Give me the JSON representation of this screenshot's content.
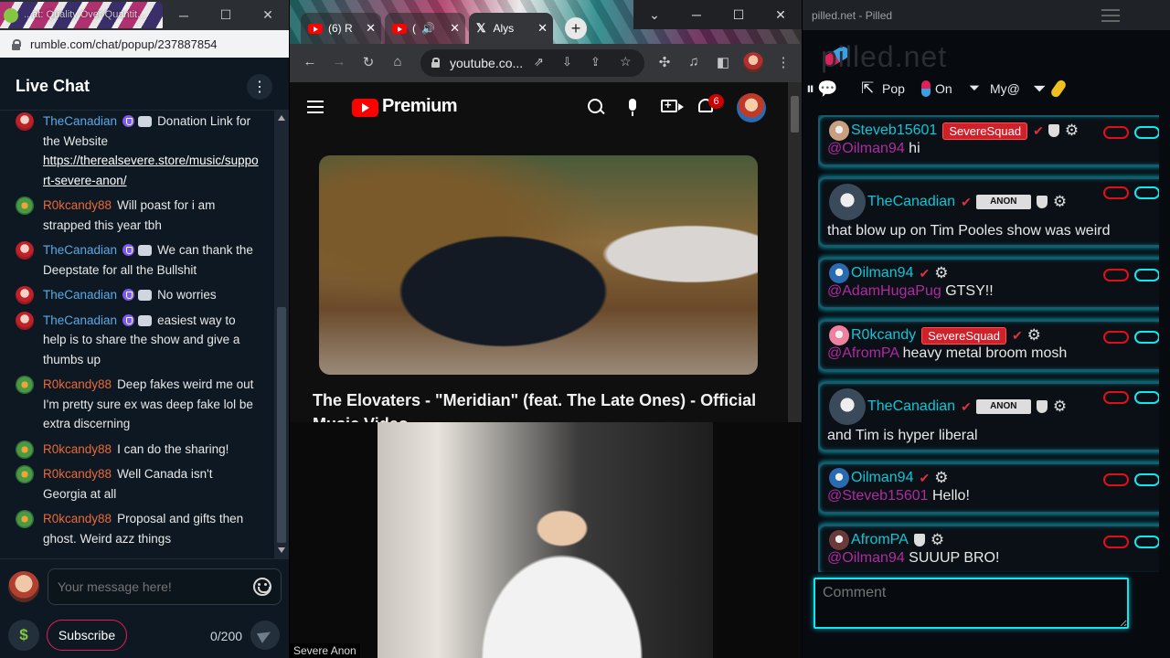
{
  "rumble": {
    "tab_title": "...at: Quality Over Quantit...",
    "url": "rumble.com/chat/popup/237887854",
    "header_title": "Live Chat",
    "messages": [
      {
        "user": "TheCanadian",
        "kind": "tc",
        "badges": true,
        "text": "Donation Link for the Website ",
        "link": "https://therealsevere.store/music/support-severe-anon/"
      },
      {
        "user": "R0kcandy88",
        "kind": "r0",
        "badges": false,
        "text": "Will poast for i am strapped this year tbh"
      },
      {
        "user": "TheCanadian",
        "kind": "tc",
        "badges": true,
        "text": "We can thank the Deepstate for all the Bullshit"
      },
      {
        "user": "TheCanadian",
        "kind": "tc",
        "badges": true,
        "text": "No worries"
      },
      {
        "user": "TheCanadian",
        "kind": "tc",
        "badges": true,
        "text": "easiest way to help is to share the show and give a thumbs up"
      },
      {
        "user": "R0kcandy88",
        "kind": "r0",
        "badges": false,
        "text": "Deep fakes weird me out I'm pretty sure ex was deep fake lol be extra discerning"
      },
      {
        "user": "R0kcandy88",
        "kind": "r0",
        "badges": false,
        "text": "I can do the sharing!"
      },
      {
        "user": "R0kcandy88",
        "kind": "r0",
        "badges": false,
        "text": "Well Canada isn't Georgia at all"
      },
      {
        "user": "R0kcandy88",
        "kind": "r0",
        "badges": false,
        "text": "Proposal and gifts then ghost. Weird azz things"
      }
    ],
    "input_placeholder": "Your message here!",
    "subscribe_label": "Subscribe",
    "char_counter": "0/200",
    "dollar_symbol": "$"
  },
  "youtube": {
    "tabs": [
      {
        "label": "(6) R"
      },
      {
        "label": "("
      },
      {
        "label": "Alys"
      }
    ],
    "url": "youtube.co...",
    "brand": "Premium",
    "notification_count": "6",
    "video_title": "The Elovaters - \"Meridian\" (feat. The Late Ones) - Official Music Video"
  },
  "webcam": {
    "label": "Severe Anon"
  },
  "pilled": {
    "window_title": "pilled.net - Pilled",
    "logo_text": "pilled.net",
    "toolbar": {
      "pop": "Pop",
      "on": "On",
      "my": "My@"
    },
    "messages": [
      {
        "user": "Steveb15601",
        "badge": "SevereSquad",
        "mention": "@Oilman94",
        "text": " hi"
      },
      {
        "user": "TheCanadian",
        "anon_badge": "ANON",
        "mention": "",
        "text": "that blow up on Tim Pooles show was weird"
      },
      {
        "user": "Oilman94",
        "mention": "@AdamHugaPug",
        "text": " GTSY!!"
      },
      {
        "user": "R0kcandy",
        "badge": "SevereSquad",
        "mention": "@AfromPA",
        "text": " heavy metal broom mosh"
      },
      {
        "user": "TheCanadian",
        "anon_badge": "ANON",
        "mention": "",
        "text": "and Tim is hyper liberal"
      },
      {
        "user": "Oilman94",
        "mention": "@Steveb15601",
        "text": " Hello!"
      },
      {
        "user": "AfromPA",
        "mention": "@Oilman94",
        "text": " SUUUP BRO!"
      }
    ],
    "comment_placeholder": "Comment"
  },
  "colors": {
    "rumble_bg": "#0e1822",
    "rumble_canadian": "#5aa9e6",
    "rumble_r0k": "#e86a3a",
    "pilled_name": "#0ac8d8",
    "pilled_glow": "#10e8f0",
    "pilled_mention": "#b02aa0",
    "squad_red": "#d0202a"
  }
}
